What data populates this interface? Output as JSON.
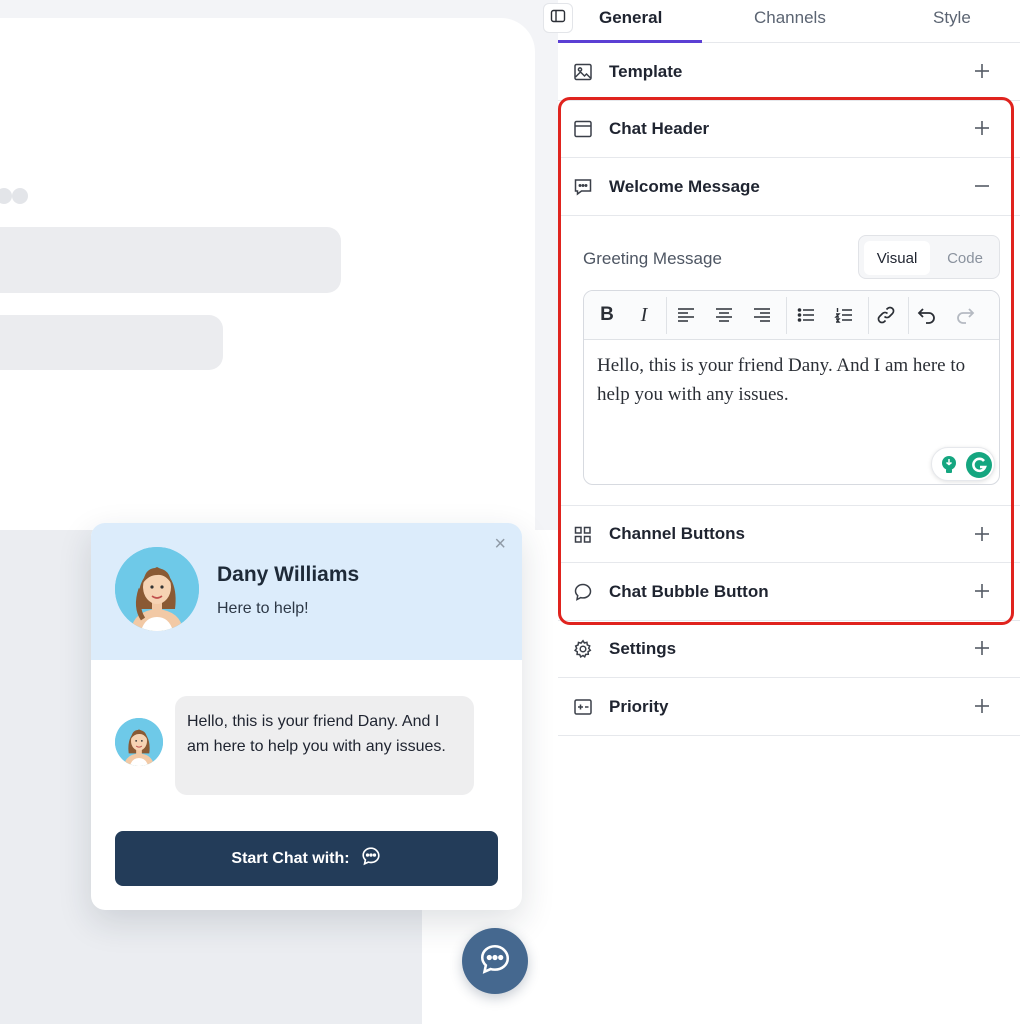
{
  "preview": {
    "agent_name": "Dany Williams",
    "agent_tagline": "Here to help!",
    "close_glyph": "×",
    "welcome_text": "Hello, this is your friend Dany. And I am here to help you with any issues.",
    "start_button_label": "Start Chat with:",
    "start_button_icon": "chat-bubble-icon",
    "fab_icon": "chat-bubble-icon"
  },
  "tabs": [
    {
      "label": "General",
      "active": true
    },
    {
      "label": "Channels",
      "active": false
    },
    {
      "label": "Style",
      "active": false
    }
  ],
  "sections": [
    {
      "label": "Template",
      "icon": "image-icon",
      "state": "collapsed"
    },
    {
      "label": "Chat Header",
      "icon": "window-icon",
      "state": "collapsed"
    },
    {
      "label": "Welcome Message",
      "icon": "message-icon",
      "state": "expanded"
    },
    {
      "label": "Channel Buttons",
      "icon": "grid-icon",
      "state": "collapsed"
    },
    {
      "label": "Chat Bubble Button",
      "icon": "speech-bubble-icon",
      "state": "collapsed"
    },
    {
      "label": "Settings",
      "icon": "gear-icon",
      "state": "collapsed"
    },
    {
      "label": "Priority",
      "icon": "priority-icon",
      "state": "collapsed"
    }
  ],
  "welcome_message": {
    "field_label": "Greeting Message",
    "mode_options": [
      "Visual",
      "Code"
    ],
    "selected_mode": "Visual",
    "toolbar": [
      "bold",
      "italic",
      "align-left",
      "align-center",
      "align-right",
      "bullet-list",
      "numbered-list",
      "link",
      "undo",
      "redo"
    ],
    "bold_label": "B",
    "italic_label": "I",
    "content": "Hello, this is your friend Dany. And I am here to help you with any issues."
  },
  "colors": {
    "accent": "#5b3fd4",
    "highlight_border": "#e0231e",
    "chat_header_bg": "#dcecfb",
    "start_button_bg": "#233c59",
    "fab_bg": "#45688f",
    "grammarly_green": "#15a680"
  }
}
